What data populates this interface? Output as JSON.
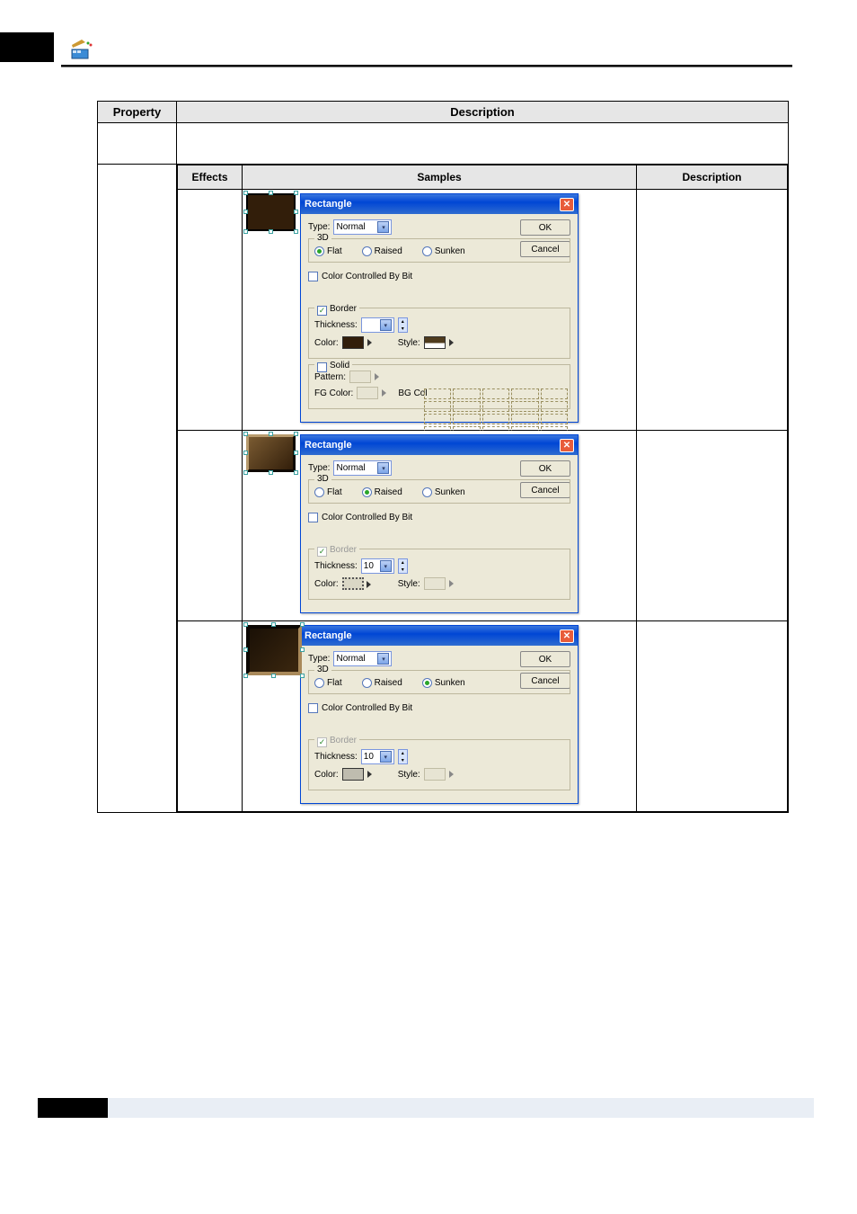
{
  "header": {
    "property": "Property",
    "description": "Description"
  },
  "inner_header": {
    "effects": "Effects",
    "samples": "Samples",
    "description": "Description"
  },
  "dialog": {
    "title": "Rectangle",
    "type_label": "Type:",
    "type_value": "Normal",
    "ok": "OK",
    "cancel": "Cancel",
    "group_3d": "3D",
    "flat": "Flat",
    "raised": "Raised",
    "sunken": "Sunken",
    "color_by_bit": "Color Controlled By Bit",
    "border": "Border",
    "thickness": "Thickness:",
    "thickness_val": "10",
    "color": "Color:",
    "style": "Style:",
    "solid": "Solid",
    "pattern": "Pattern:",
    "fg_color": "FG Color:",
    "bg_color": "BG Col"
  }
}
